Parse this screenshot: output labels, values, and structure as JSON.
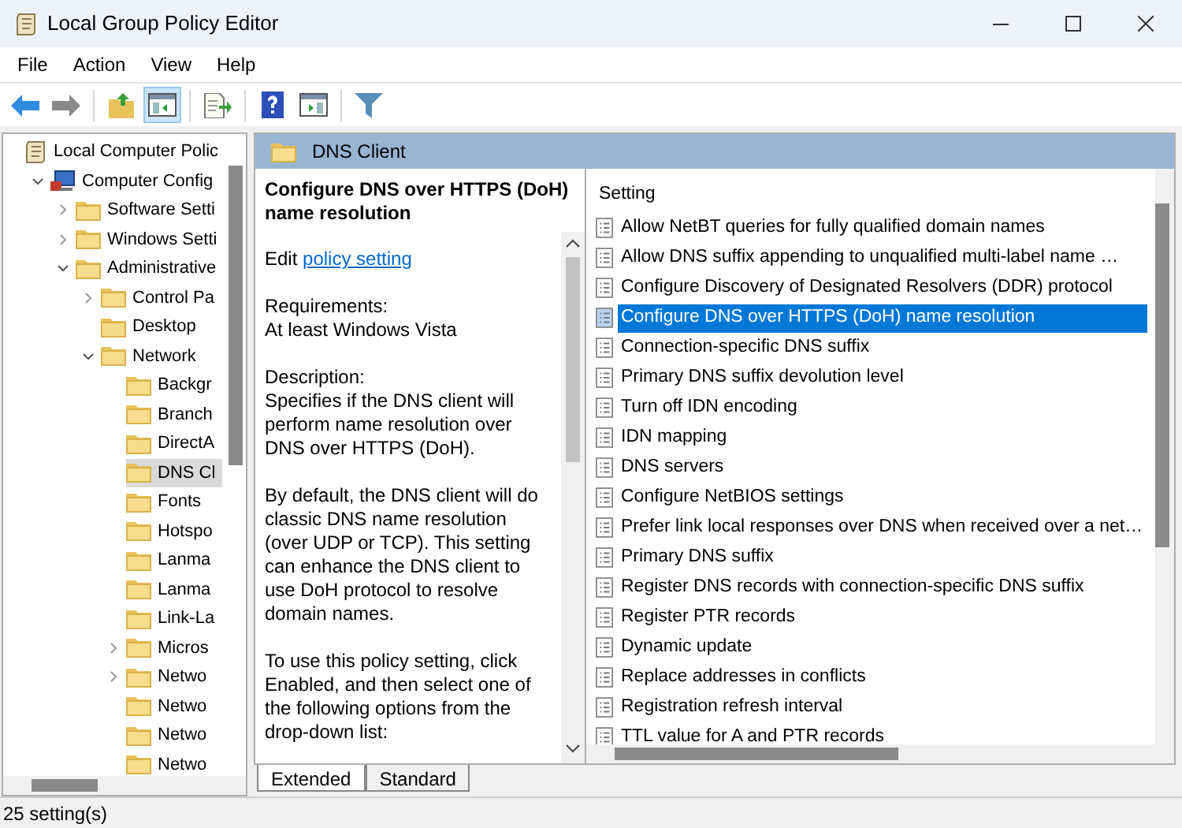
{
  "window": {
    "title": "Local Group Policy Editor"
  },
  "menu": [
    "File",
    "Action",
    "View",
    "Help"
  ],
  "toolbar": [
    {
      "kind": "back",
      "pressed": false
    },
    {
      "kind": "forward",
      "pressed": false
    },
    {
      "kind": "sep"
    },
    {
      "kind": "up",
      "pressed": false
    },
    {
      "kind": "tree",
      "pressed": true
    },
    {
      "kind": "sep"
    },
    {
      "kind": "export",
      "pressed": false
    },
    {
      "kind": "sep"
    },
    {
      "kind": "help",
      "pressed": false
    },
    {
      "kind": "pane",
      "pressed": false
    },
    {
      "kind": "sep"
    },
    {
      "kind": "filter",
      "pressed": false
    }
  ],
  "tree": [
    {
      "label": "Local Computer Polic",
      "kind": "policy",
      "selected": false,
      "children": [
        {
          "label": "Computer Config",
          "kind": "computer",
          "expanded": true,
          "selected": false,
          "children": [
            {
              "label": "Software Setti",
              "kind": "folder",
              "expanded": false,
              "selected": false
            },
            {
              "label": "Windows Setti",
              "kind": "folder",
              "expanded": false,
              "selected": false
            },
            {
              "label": "Administrative",
              "kind": "folder",
              "expanded": true,
              "selected": false,
              "children": [
                {
                  "label": "Control Pa",
                  "kind": "folder",
                  "expanded": false,
                  "selected": false
                },
                {
                  "label": "Desktop",
                  "kind": "folder",
                  "selected": false
                },
                {
                  "label": "Network",
                  "kind": "folder",
                  "expanded": true,
                  "selected": false,
                  "children": [
                    {
                      "label": "Backgr",
                      "kind": "folder",
                      "selected": false
                    },
                    {
                      "label": "Branch",
                      "kind": "folder",
                      "selected": false
                    },
                    {
                      "label": "DirectA",
                      "kind": "folder",
                      "selected": false
                    },
                    {
                      "label": "DNS Cl",
                      "kind": "folder",
                      "selected": true
                    },
                    {
                      "label": "Fonts",
                      "kind": "folder",
                      "selected": false
                    },
                    {
                      "label": "Hotspo",
                      "kind": "folder",
                      "selected": false
                    },
                    {
                      "label": "Lanma",
                      "kind": "folder",
                      "selected": false
                    },
                    {
                      "label": "Lanma",
                      "kind": "folder",
                      "selected": false
                    },
                    {
                      "label": "Link-La",
                      "kind": "folder",
                      "selected": false
                    },
                    {
                      "label": "Micros",
                      "kind": "folder",
                      "expanded": false,
                      "selected": false
                    },
                    {
                      "label": "Netwo",
                      "kind": "folder",
                      "expanded": false,
                      "selected": false
                    },
                    {
                      "label": "Netwo",
                      "kind": "folder",
                      "selected": false
                    },
                    {
                      "label": "Netwo",
                      "kind": "folder",
                      "selected": false
                    },
                    {
                      "label": "Netwo",
                      "kind": "folder",
                      "selected": false
                    }
                  ]
                }
              ]
            }
          ]
        }
      ]
    }
  ],
  "header": {
    "title": "DNS Client"
  },
  "description": {
    "title": "Configure DNS over HTTPS (DoH) name resolution",
    "edit_prefix": "Edit",
    "link": "policy setting",
    "blocks": [
      [
        "Requirements:",
        "At least Windows Vista"
      ],
      [
        "Description:",
        "Specifies if the DNS client will perform name resolution over DNS over HTTPS (DoH)."
      ],
      [
        "By default, the DNS client will do classic DNS name resolution (over UDP or TCP). This setting can enhance the DNS client to use DoH protocol to resolve domain names."
      ],
      [
        "To use this policy setting, click Enabled, and then select one of the following options from the drop-down list:"
      ]
    ]
  },
  "settings": {
    "column": "Setting",
    "rows": [
      {
        "label": "Allow NetBT queries for fully qualified domain names",
        "selected": false
      },
      {
        "label": "Allow DNS suffix appending to unqualified multi-label name …",
        "selected": false
      },
      {
        "label": "Configure Discovery of Designated Resolvers (DDR) protocol",
        "selected": false
      },
      {
        "label": "Configure DNS over HTTPS (DoH) name resolution",
        "selected": true
      },
      {
        "label": "Connection-specific DNS suffix",
        "selected": false
      },
      {
        "label": "Primary DNS suffix devolution level",
        "selected": false
      },
      {
        "label": "Turn off IDN encoding",
        "selected": false
      },
      {
        "label": "IDN mapping",
        "selected": false
      },
      {
        "label": "DNS servers",
        "selected": false
      },
      {
        "label": "Configure NetBIOS settings",
        "selected": false
      },
      {
        "label": "Prefer link local responses over DNS when received over a net…",
        "selected": false
      },
      {
        "label": "Primary DNS suffix",
        "selected": false
      },
      {
        "label": "Register DNS records with connection-specific DNS suffix",
        "selected": false
      },
      {
        "label": "Register PTR records",
        "selected": false
      },
      {
        "label": "Dynamic update",
        "selected": false
      },
      {
        "label": "Replace addresses in conflicts",
        "selected": false
      },
      {
        "label": "Registration refresh interval",
        "selected": false
      },
      {
        "label": "TTL value for A and PTR records",
        "selected": false
      }
    ]
  },
  "view_tabs": [
    {
      "label": "Extended",
      "selected": true
    },
    {
      "label": "Standard",
      "selected": false
    }
  ],
  "status_bar": {
    "text": "25 setting(s)"
  }
}
